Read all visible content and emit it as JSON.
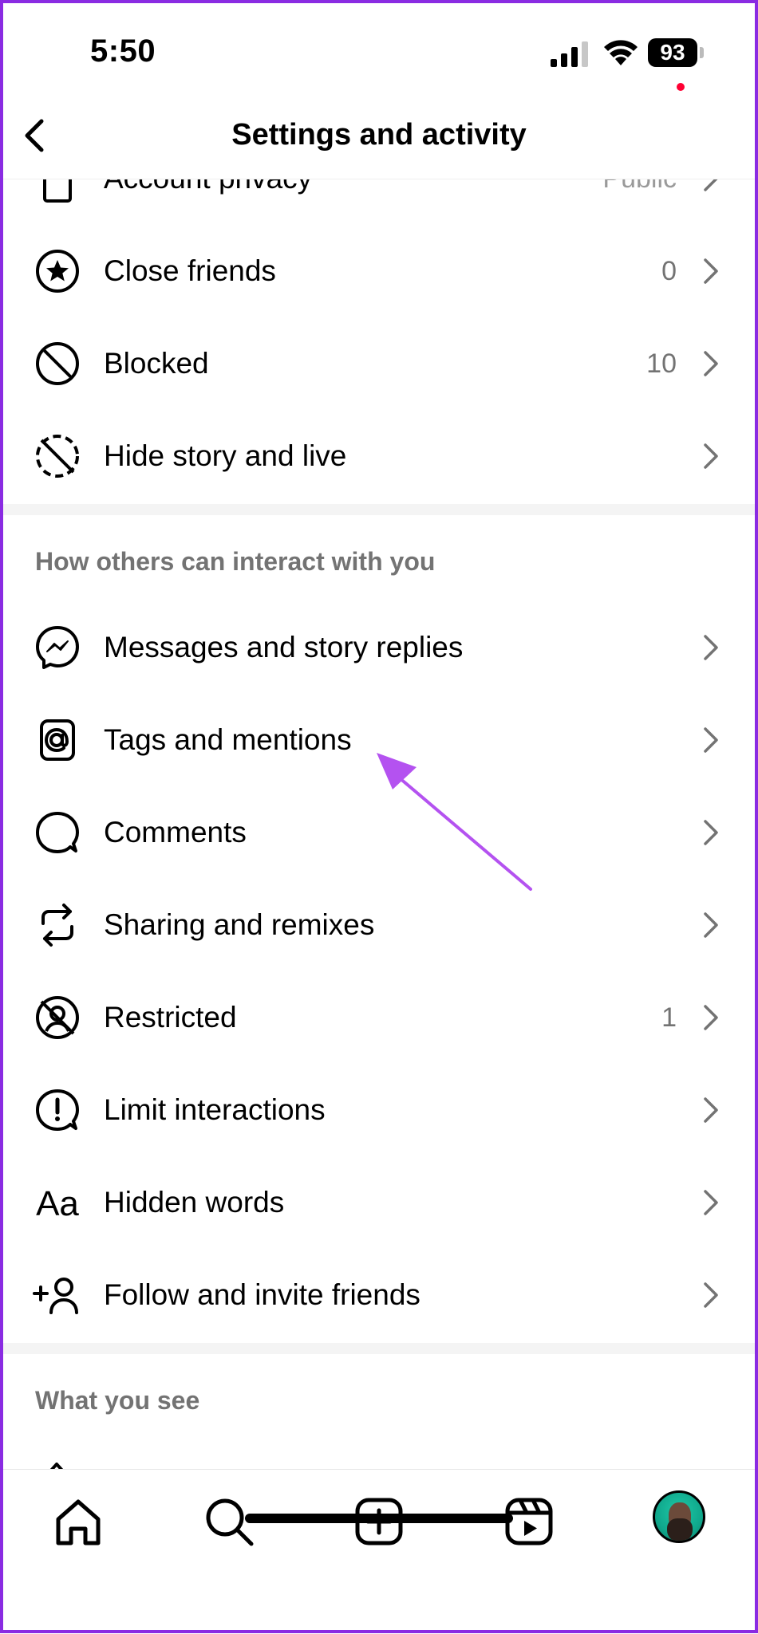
{
  "status_bar": {
    "time": "5:50",
    "battery_level": "93"
  },
  "header": {
    "title": "Settings and activity"
  },
  "rows_top": [
    {
      "label": "Account privacy",
      "value": "Public",
      "icon": "lock-icon"
    },
    {
      "label": "Close friends",
      "value": "0",
      "icon": "star-circle-icon"
    },
    {
      "label": "Blocked",
      "value": "10",
      "icon": "blocked-icon"
    },
    {
      "label": "Hide story and live",
      "value": "",
      "icon": "hide-story-icon"
    }
  ],
  "section_interact": {
    "title": "How others can interact with you",
    "rows": [
      {
        "label": "Messages and story replies",
        "value": "",
        "icon": "messenger-icon"
      },
      {
        "label": "Tags and mentions",
        "value": "",
        "icon": "at-sign-icon"
      },
      {
        "label": "Comments",
        "value": "",
        "icon": "comment-icon"
      },
      {
        "label": "Sharing and remixes",
        "value": "",
        "icon": "remix-icon"
      },
      {
        "label": "Restricted",
        "value": "1",
        "icon": "restricted-icon"
      },
      {
        "label": "Limit interactions",
        "value": "",
        "icon": "limit-icon"
      },
      {
        "label": "Hidden words",
        "value": "",
        "icon": "hidden-words-icon"
      },
      {
        "label": "Follow and invite friends",
        "value": "",
        "icon": "add-person-icon"
      }
    ]
  },
  "section_see": {
    "title": "What you see"
  },
  "bottom_nav": [
    "home-icon",
    "search-icon",
    "create-icon",
    "reels-icon",
    "profile-avatar"
  ],
  "colors": {
    "annotation_arrow": "#b452f0",
    "secondary_text": "#737373",
    "frame": "#8a2be2"
  }
}
